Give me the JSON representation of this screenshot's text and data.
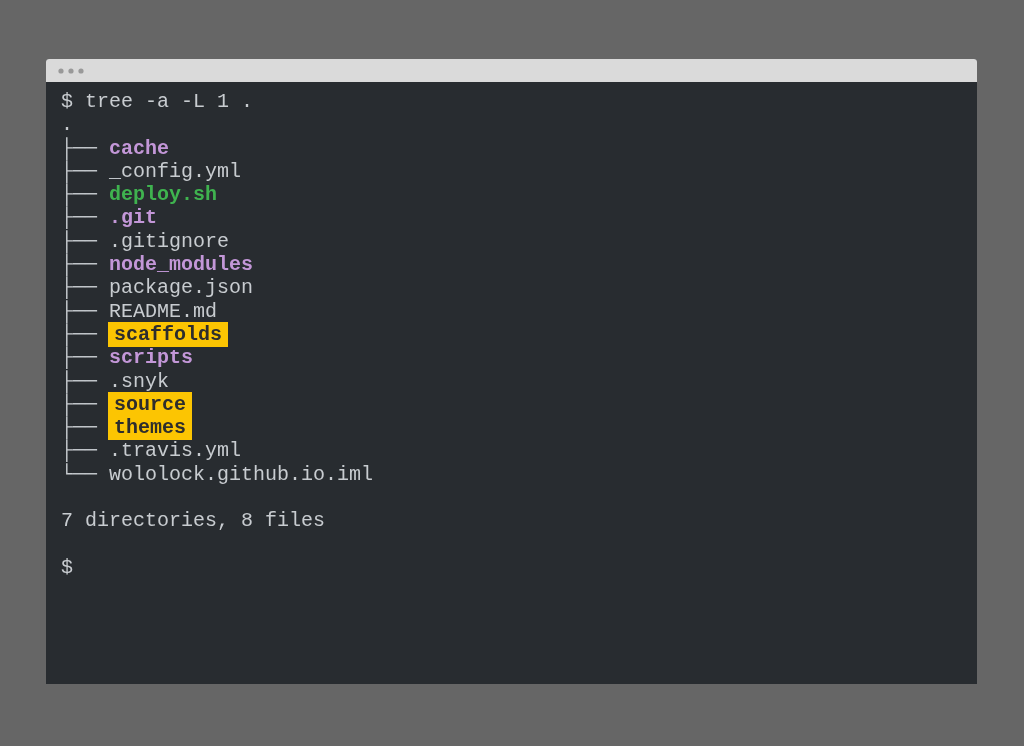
{
  "terminal": {
    "command": "$ tree -a -L 1 .",
    "root": ".",
    "entries": [
      {
        "branch": "├──",
        "name": "cache",
        "kind": "dir"
      },
      {
        "branch": "├──",
        "name": "_config.yml",
        "kind": "file"
      },
      {
        "branch": "├──",
        "name": "deploy.sh",
        "kind": "exec"
      },
      {
        "branch": "├──",
        "name": ".git",
        "kind": "dir"
      },
      {
        "branch": "├──",
        "name": ".gitignore",
        "kind": "file"
      },
      {
        "branch": "├──",
        "name": "node_modules",
        "kind": "dir"
      },
      {
        "branch": "├──",
        "name": "package.json",
        "kind": "file"
      },
      {
        "branch": "├──",
        "name": "README.md",
        "kind": "file"
      },
      {
        "branch": "├──",
        "name": "scaffolds",
        "kind": "sticky"
      },
      {
        "branch": "├──",
        "name": "scripts",
        "kind": "dir"
      },
      {
        "branch": "├──",
        "name": ".snyk",
        "kind": "file"
      },
      {
        "branch": "├──",
        "name": "source",
        "kind": "sticky"
      },
      {
        "branch": "├──",
        "name": "themes",
        "kind": "sticky"
      },
      {
        "branch": "├──",
        "name": ".travis.yml",
        "kind": "file"
      },
      {
        "branch": "└──",
        "name": "wololock.github.io.iml",
        "kind": "file"
      }
    ],
    "summary": "7 directories, 8 files",
    "prompt": "$"
  }
}
